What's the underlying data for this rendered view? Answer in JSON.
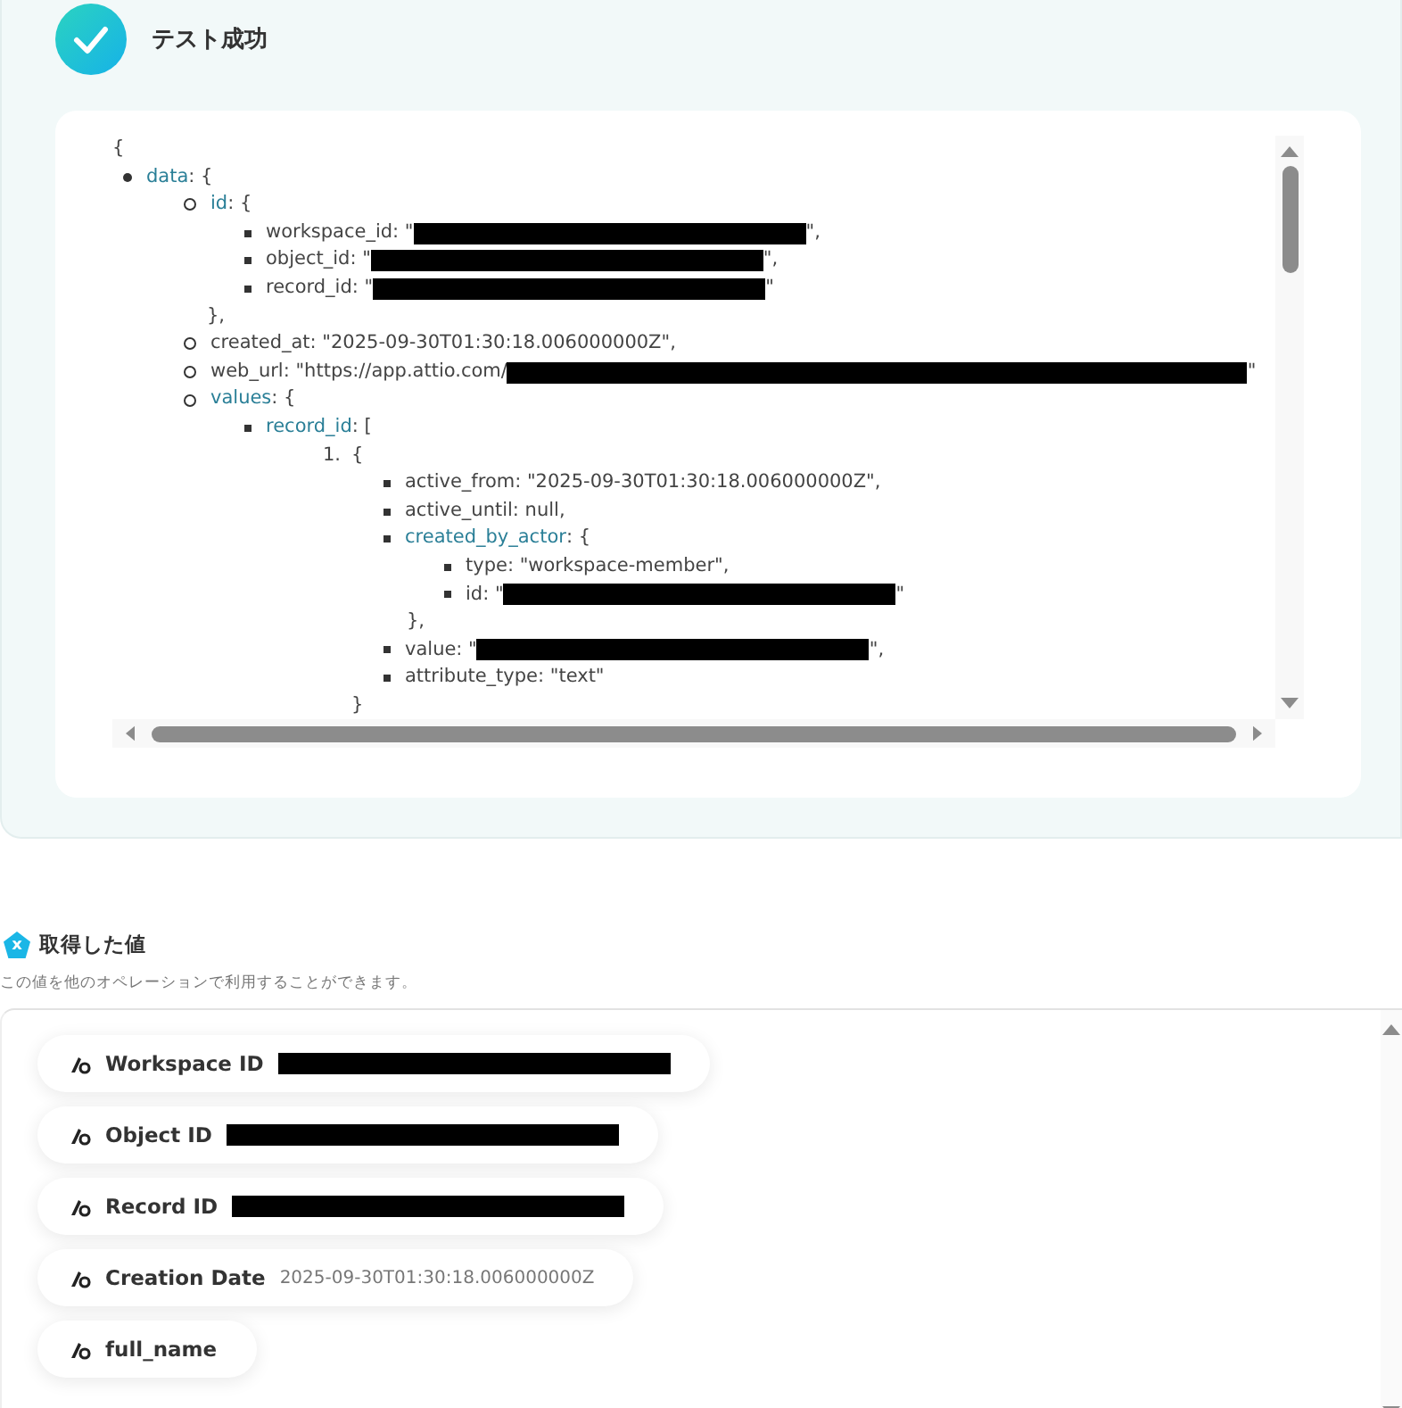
{
  "test_result": {
    "title": "テスト成功",
    "open": "{",
    "tree": [
      {
        "key": "data",
        "open": ": {",
        "children": [
          {
            "key": "id",
            "open": ": {",
            "close": "},",
            "children": [
              {
                "text": "workspace_id: \"",
                "redacted": true,
                "after": "\","
              },
              {
                "text": "object_id: \"",
                "redacted": true,
                "after": "\","
              },
              {
                "text": "record_id: \"",
                "redacted": true,
                "after": "\""
              }
            ]
          },
          {
            "text": "created_at: \"2025-09-30T01:30:18.006000000Z\","
          },
          {
            "text": "web_url: \"https://app.attio.com/",
            "redacted": true,
            "after": "\""
          },
          {
            "key": "values",
            "open": ": {",
            "children": [
              {
                "key": "record_id",
                "open": ": [",
                "children": [
                  {
                    "marker": "1.",
                    "open": "{",
                    "close": "}",
                    "children": [
                      {
                        "text": "active_from: \"2025-09-30T01:30:18.006000000Z\","
                      },
                      {
                        "text": "active_until: null,"
                      },
                      {
                        "key": "created_by_actor",
                        "open": ": {",
                        "close": "},",
                        "children": [
                          {
                            "text": "type: \"workspace-member\","
                          },
                          {
                            "text": "id: \"",
                            "redacted": true,
                            "after": "\""
                          }
                        ]
                      },
                      {
                        "text": "value: \"",
                        "redacted": true,
                        "after": "\","
                      },
                      {
                        "text": "attribute_type: \"text\""
                      }
                    ]
                  }
                ]
              }
            ]
          }
        ]
      }
    ]
  },
  "values_section": {
    "badge": "x",
    "title": "取得した値",
    "subtitle": "この値を他のオペレーションで利用することができます。",
    "fields": [
      {
        "label": "Workspace ID",
        "redacted": true
      },
      {
        "label": "Object ID",
        "redacted": true
      },
      {
        "label": "Record ID",
        "redacted": true
      },
      {
        "label": "Creation Date",
        "value": "2025-09-30T01:30:18.006000000Z"
      },
      {
        "label": "full_name"
      }
    ]
  }
}
